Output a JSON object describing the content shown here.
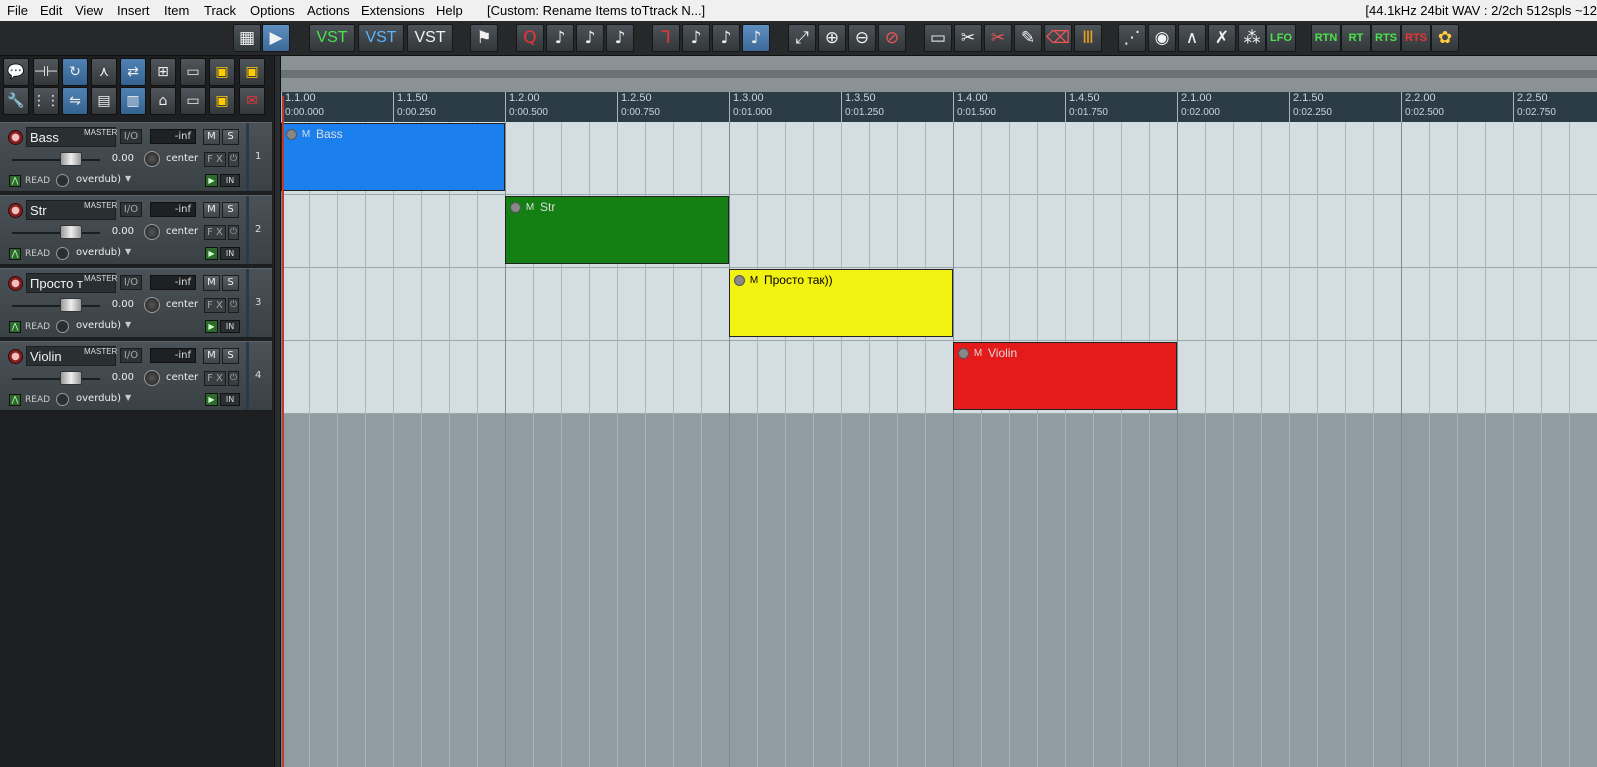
{
  "menu": [
    "File",
    "Edit",
    "View",
    "Insert",
    "Item",
    "Track",
    "Options",
    "Actions",
    "Extensions",
    "Help"
  ],
  "title": "[Custom: Rename Items toTtrack N...]",
  "status": "[44.1kHz 24bit WAV : 2/2ch 512spls ~12",
  "toolbar": {
    "vst_labels": [
      "VST",
      "VST",
      "VST"
    ],
    "rt_labels": [
      "RTN",
      "RT",
      "RTS",
      "RTS"
    ],
    "lfo_label": "LFO"
  },
  "tracks": [
    {
      "num": "1",
      "name": "Bass",
      "master": "MASTER",
      "io": "I/O",
      "vu": "-inf",
      "mute": "M",
      "solo": "S",
      "volume": "0.00",
      "pan": "center",
      "fx": "F X",
      "auto": "READ",
      "mode": "overdub)",
      "in": "IN"
    },
    {
      "num": "2",
      "name": "Str",
      "master": "MASTER",
      "io": "I/O",
      "vu": "-inf",
      "mute": "M",
      "solo": "S",
      "volume": "0.00",
      "pan": "center",
      "fx": "F X",
      "auto": "READ",
      "mode": "overdub)",
      "in": "IN"
    },
    {
      "num": "3",
      "name": "Просто т",
      "master": "MASTER",
      "io": "I/O",
      "vu": "-inf",
      "mute": "M",
      "solo": "S",
      "volume": "0.00",
      "pan": "center",
      "fx": "F X",
      "auto": "READ",
      "mode": "overdub)",
      "in": "IN"
    },
    {
      "num": "4",
      "name": "Violin",
      "master": "MASTER",
      "io": "I/O",
      "vu": "-inf",
      "mute": "M",
      "solo": "S",
      "volume": "0.00",
      "pan": "center",
      "fx": "F X",
      "auto": "READ",
      "mode": "overdub)",
      "in": "IN"
    }
  ],
  "ruler": {
    "measures": [
      "1.1.00",
      "1.1.50",
      "1.2.00",
      "1.2.50",
      "1.3.00",
      "1.3.50",
      "1.4.00",
      "1.4.50",
      "2.1.00",
      "2.1.50",
      "2.2.00",
      "2.2.50"
    ],
    "times": [
      "0:00.000",
      "0:00.250",
      "0:00.500",
      "0:00.750",
      "0:01.000",
      "0:01.250",
      "0:01.500",
      "0:01.750",
      "0:02.000",
      "0:02.250",
      "0:02.500",
      "0:02.750"
    ]
  },
  "items": [
    {
      "label": "Bass",
      "mute": "M",
      "color": "#1b80ee"
    },
    {
      "label": "Str",
      "mute": "M",
      "color": "#148014"
    },
    {
      "label": "Просто так))",
      "mute": "M",
      "color": "#f2f212"
    },
    {
      "label": "Violin",
      "mute": "M",
      "color": "#e51b1b"
    }
  ]
}
